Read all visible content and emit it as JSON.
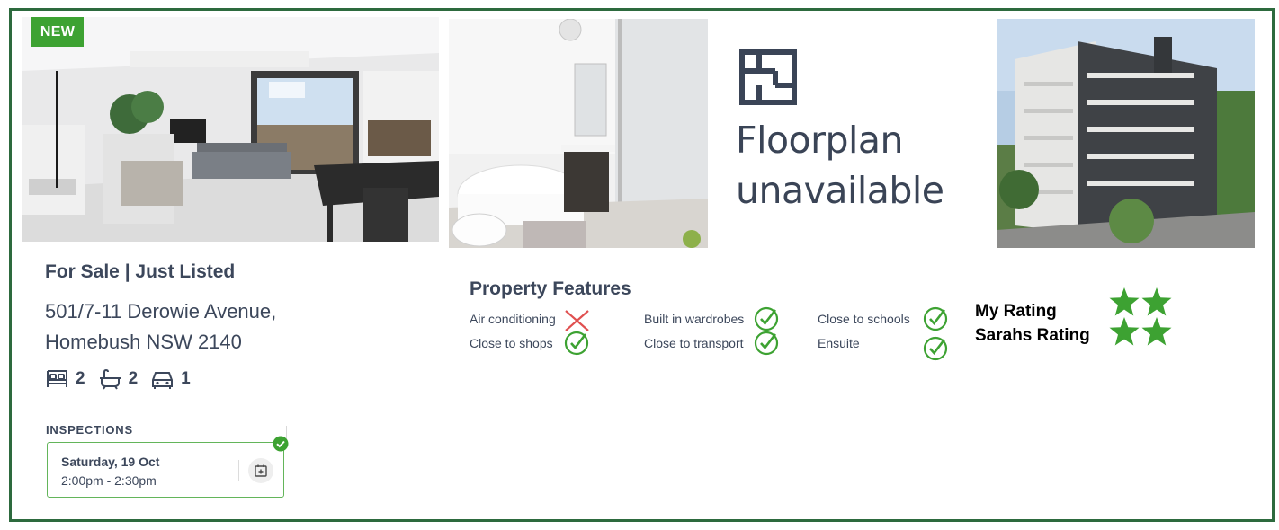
{
  "badge": {
    "label": "NEW"
  },
  "floorplan": {
    "line1": "Floorplan",
    "line2": "unavailable"
  },
  "listing": {
    "status": "For Sale | Just Listed",
    "address_line1": "501/7-11 Derowie Avenue,",
    "address_line2": "Homebush NSW 2140",
    "bedrooms": "2",
    "bathrooms": "2",
    "parking": "1"
  },
  "inspections": {
    "title": "INSPECTIONS",
    "day": "Saturday, 19 Oct",
    "time": "2:00pm - 2:30pm"
  },
  "features": {
    "title": "Property Features",
    "items": [
      {
        "label": "Air conditioning",
        "status": "no"
      },
      {
        "label": "Close to shops",
        "status": "yes"
      },
      {
        "label": "Built in wardrobes",
        "status": "yes"
      },
      {
        "label": "Close to transport",
        "status": "yes"
      },
      {
        "label": "Close to schools",
        "status": "yes"
      },
      {
        "label": "Ensuite",
        "status": "yes"
      }
    ]
  },
  "ratings": [
    {
      "label": "My Rating",
      "stars": 2
    },
    {
      "label": "Sarahs Rating",
      "stars": 2
    }
  ],
  "colors": {
    "frame": "#2d6a3e",
    "accent_green": "#3da232",
    "cross_red": "#e05050",
    "text": "#3c475b"
  },
  "icons": [
    "bed-icon",
    "bath-icon",
    "car-icon",
    "calendar-add-icon",
    "check-circle-icon",
    "cross-icon",
    "star-icon",
    "floorplan-icon"
  ]
}
